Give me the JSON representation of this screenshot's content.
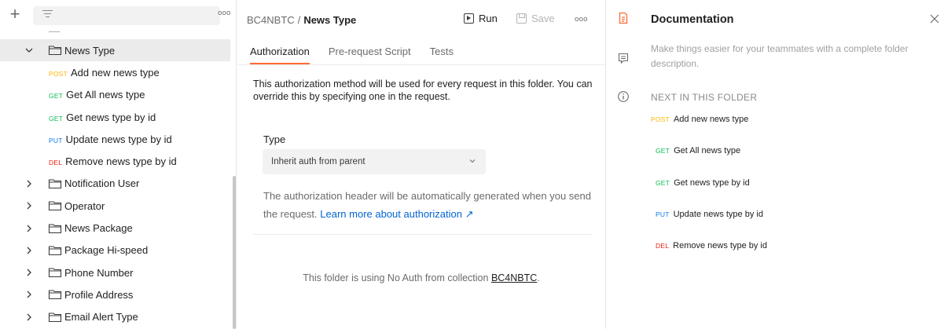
{
  "sidebar": {
    "new_icon": "plus-icon",
    "filter_icon": "filter-icon",
    "more_icon": "more-icon",
    "more_glyph": "ooo",
    "active_folder": {
      "label": "News Type",
      "icon": "folder-icon",
      "expanded": true
    },
    "requests": [
      {
        "method": "POST",
        "label": "Add new news type"
      },
      {
        "method": "GET",
        "label": "Get All news type"
      },
      {
        "method": "GET",
        "label": "Get news type by id"
      },
      {
        "method": "PUT",
        "label": "Update news type by id"
      },
      {
        "method": "DEL",
        "label": "Remove news type by id"
      }
    ],
    "folders": [
      {
        "label": "Notification User"
      },
      {
        "label": "Operator"
      },
      {
        "label": "News Package"
      },
      {
        "label": "Package Hi-speed"
      },
      {
        "label": "Phone Number"
      },
      {
        "label": "Profile Address"
      },
      {
        "label": "Email Alert Type"
      }
    ]
  },
  "header": {
    "collection": "BC4NBTC",
    "separator": "/",
    "current": "News Type",
    "run_label": "Run",
    "save_label": "Save",
    "more_glyph": "ooo"
  },
  "tabs": [
    {
      "label": "Authorization",
      "active": true
    },
    {
      "label": "Pre-request Script",
      "active": false
    },
    {
      "label": "Tests",
      "active": false
    }
  ],
  "auth": {
    "description": "This authorization method will be used for every request in this folder. You can override this by specifying one in the request.",
    "type_label": "Type",
    "type_value": "Inherit auth from parent",
    "note": "The authorization header will be automatically generated when you send the request.",
    "learn_more": "Learn more about authorization ↗",
    "noauth_prefix": "This folder is using No Auth from collection",
    "noauth_collection": "BC4NBTC",
    "noauth_suffix": "."
  },
  "documentation": {
    "title": "Documentation",
    "description": "Make things easier for your teammates with a complete folder description.",
    "next_heading": "NEXT IN THIS FOLDER",
    "items": [
      {
        "method": "POST",
        "label": "Add new news type"
      },
      {
        "method": "GET",
        "label": "Get All news type"
      },
      {
        "method": "GET",
        "label": "Get news type by id"
      },
      {
        "method": "PUT",
        "label": "Update news type by id"
      },
      {
        "method": "DEL",
        "label": "Remove news type by id"
      }
    ]
  },
  "colors": {
    "post": "#ffb400",
    "get": "#0cbb52",
    "put": "#097bed",
    "del": "#eb2013",
    "accent": "#ff6c37",
    "link": "#0265d2"
  }
}
